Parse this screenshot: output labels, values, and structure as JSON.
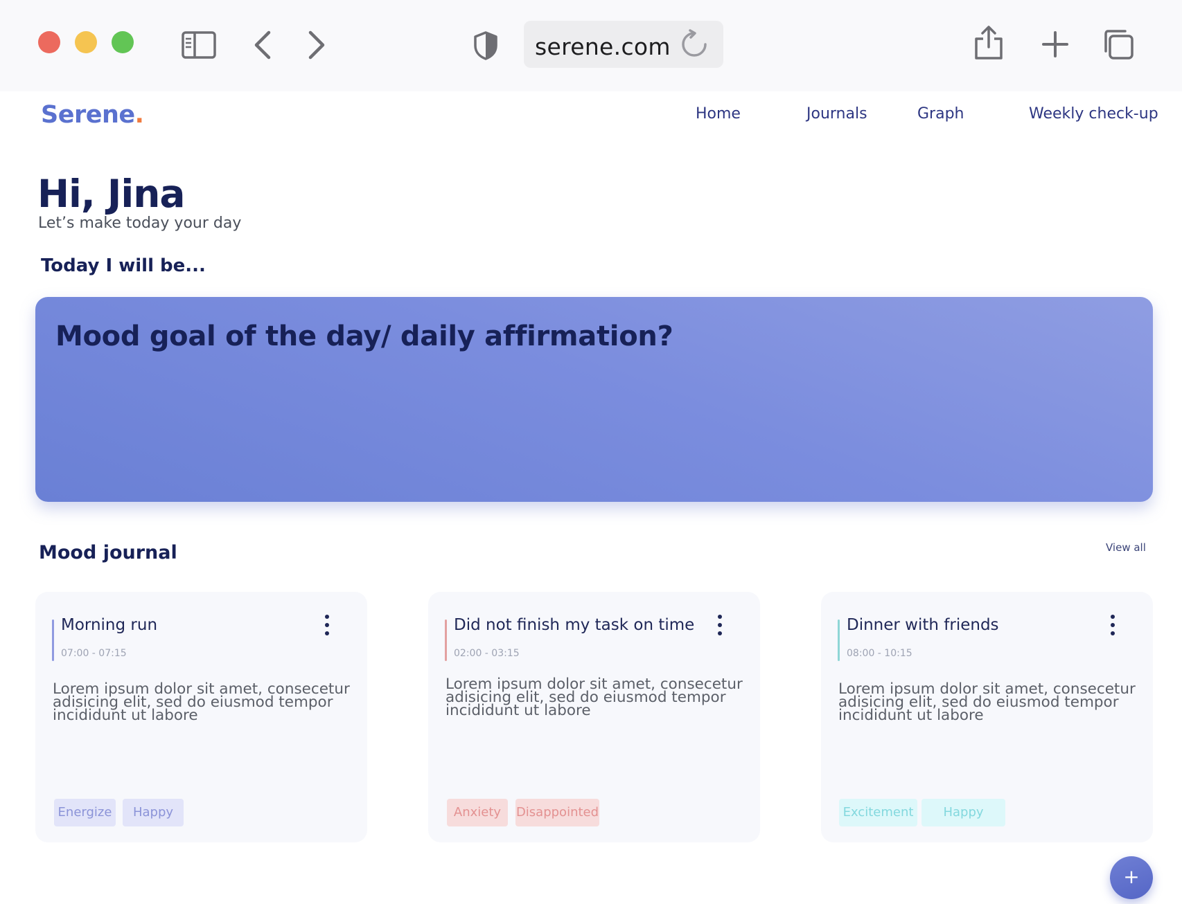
{
  "browser": {
    "url": "serene.com",
    "icons": [
      "close-icon",
      "minimize-icon",
      "zoom-icon",
      "sidebar-icon",
      "back-icon",
      "forward-icon",
      "shield-icon",
      "reload-icon",
      "share-icon",
      "new-tab-icon",
      "tabs-overview-icon"
    ]
  },
  "header": {
    "logo": "Serene",
    "logo_dot": ".",
    "nav": [
      "Home",
      "Journals",
      "Graph",
      "Weekly check-up"
    ]
  },
  "greeting": {
    "title": "Hi, Jina",
    "subtitle": "Let’s make today your day"
  },
  "today": {
    "heading": "Today I will be...",
    "placeholder": "Mood goal of the day/ daily affirmation?"
  },
  "journal": {
    "heading": "Mood journal",
    "view_all": "View all",
    "entries": [
      {
        "title": "Morning run",
        "time": "07:00 - 07:15",
        "body_lines": [
          "Lorem ipsum dolor sit amet, consecetur",
          "adisicing elit, sed do eiusmod tempor",
          "incididunt ut labore"
        ],
        "tags": [
          "Energize",
          "Happy"
        ],
        "accent_color": "#8f9ae0"
      },
      {
        "title": "Did not finish my task on time",
        "time": "02:00 - 03:15",
        "body_lines": [
          "Lorem ipsum dolor sit amet, consecetur",
          "adisicing elit, sed do eiusmod tempor",
          "incididunt ut labore"
        ],
        "tags": [
          "Anxiety",
          "Disappointed"
        ],
        "accent_color": "#e3a0a0"
      },
      {
        "title": "Dinner with friends",
        "time": "08:00 - 10:15",
        "body_lines": [
          "Lorem ipsum dolor sit amet, consecetur",
          "adisicing elit, sed do eiusmod tempor",
          "incididunt ut labore"
        ],
        "tags": [
          "Excitement",
          "Happy"
        ],
        "accent_color": "#8fd6d6"
      }
    ]
  },
  "fab": {
    "label": "+",
    "icon": "add-icon"
  },
  "colors": {
    "brand": "#5a71cf",
    "logo_dot": "#f07b3f",
    "heading": "#172157",
    "tag_purple_bg": "#e2e4f9",
    "tag_purple_text": "#8b93d8",
    "tag_red_bg": "#f7dcdc",
    "tag_red_text": "#e39191",
    "tag_teal_bg": "#ddf8fa",
    "tag_teal_text": "#83d8de"
  }
}
